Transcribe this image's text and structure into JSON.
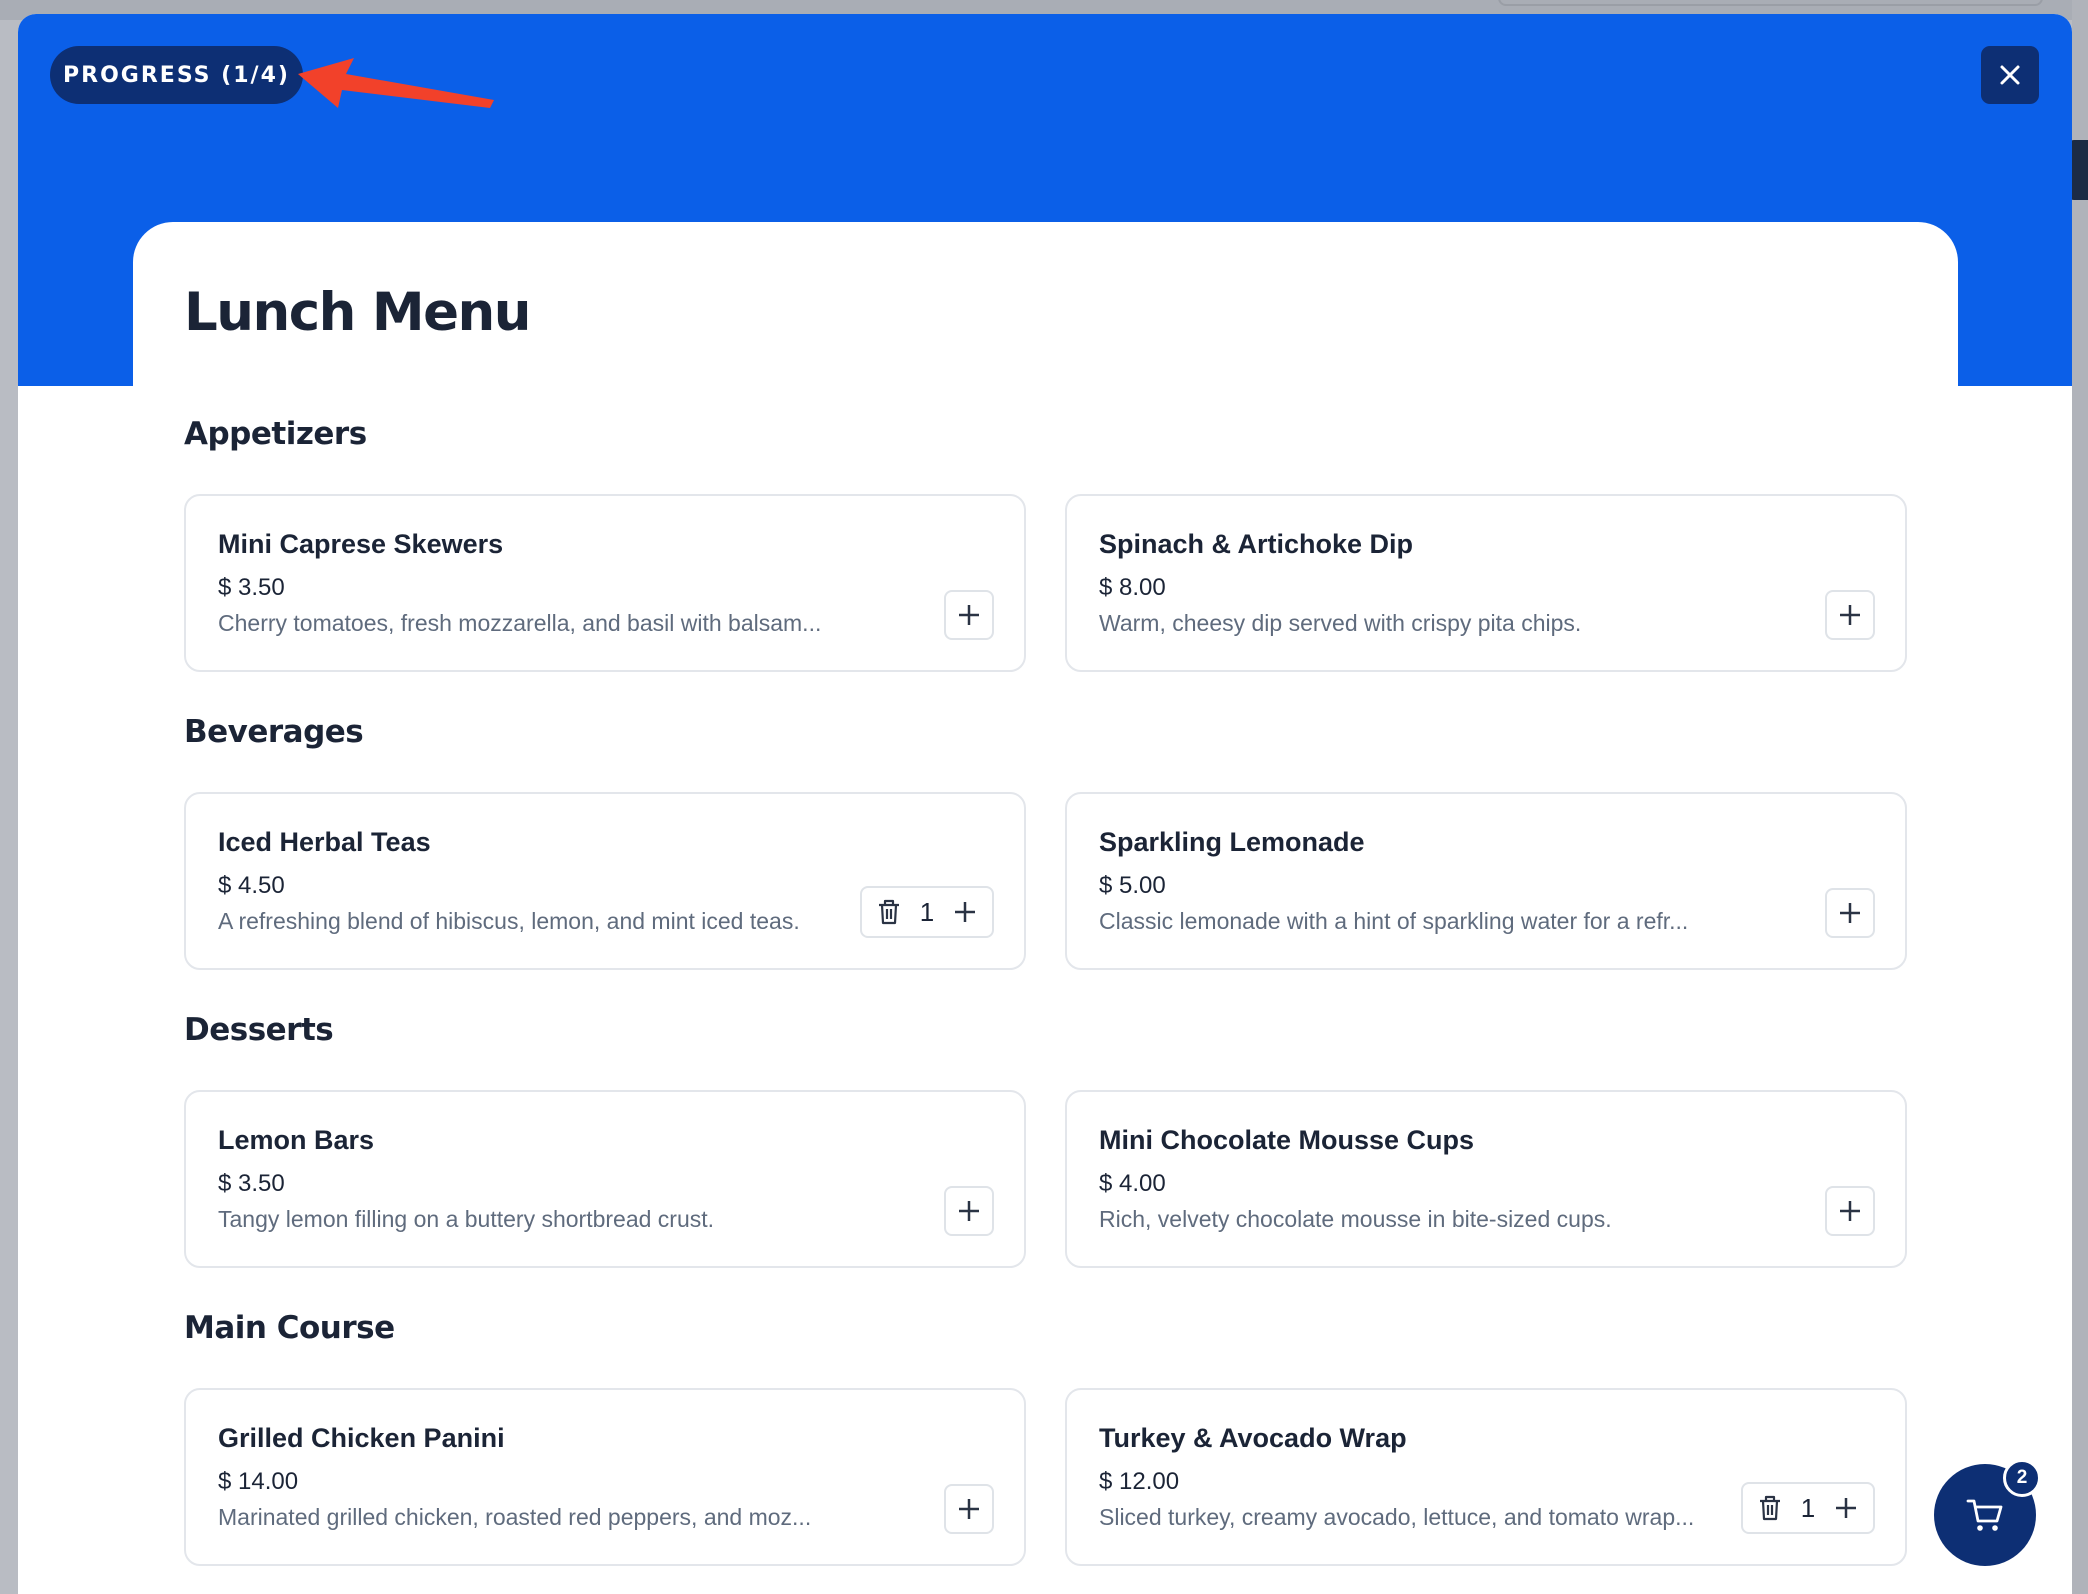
{
  "header": {
    "progress_label": "PROGRESS (1/4)",
    "close_icon": "close-icon"
  },
  "menu": {
    "title": "Lunch Menu",
    "sections": [
      {
        "title": "Appetizers",
        "items": [
          {
            "name": "Mini Caprese Skewers",
            "price": "$ 3.50",
            "description": "Cherry tomatoes, fresh mozzarella, and basil with balsam...",
            "quantity": null
          },
          {
            "name": "Spinach & Artichoke Dip",
            "price": "$ 8.00",
            "description": "Warm, cheesy dip served with crispy pita chips.",
            "quantity": null
          }
        ]
      },
      {
        "title": "Beverages",
        "items": [
          {
            "name": "Iced Herbal Teas",
            "price": "$ 4.50",
            "description": "A refreshing blend of hibiscus, lemon, and mint iced teas.",
            "quantity": "1"
          },
          {
            "name": "Sparkling Lemonade",
            "price": "$ 5.00",
            "description": "Classic lemonade with a hint of sparkling water for a refr...",
            "quantity": null
          }
        ]
      },
      {
        "title": "Desserts",
        "items": [
          {
            "name": "Lemon Bars",
            "price": "$ 3.50",
            "description": "Tangy lemon filling on a buttery shortbread crust.",
            "quantity": null
          },
          {
            "name": "Mini Chocolate Mousse Cups",
            "price": "$ 4.00",
            "description": "Rich, velvety chocolate mousse in bite-sized cups.",
            "quantity": null
          }
        ]
      },
      {
        "title": "Main Course",
        "items": [
          {
            "name": "Grilled Chicken Panini",
            "price": "$ 14.00",
            "description": "Marinated grilled chicken, roasted red peppers, and moz...",
            "quantity": null
          },
          {
            "name": "Turkey & Avocado Wrap",
            "price": "$ 12.00",
            "description": "Sliced turkey, creamy avocado, lettuce, and tomato wrap...",
            "quantity": "1"
          }
        ]
      }
    ]
  },
  "cart": {
    "count": "2",
    "icon": "cart-icon"
  },
  "colors": {
    "hero_blue": "#0b5fe8",
    "dark_navy": "#0d2f74",
    "annotation_red": "#f2412a"
  }
}
